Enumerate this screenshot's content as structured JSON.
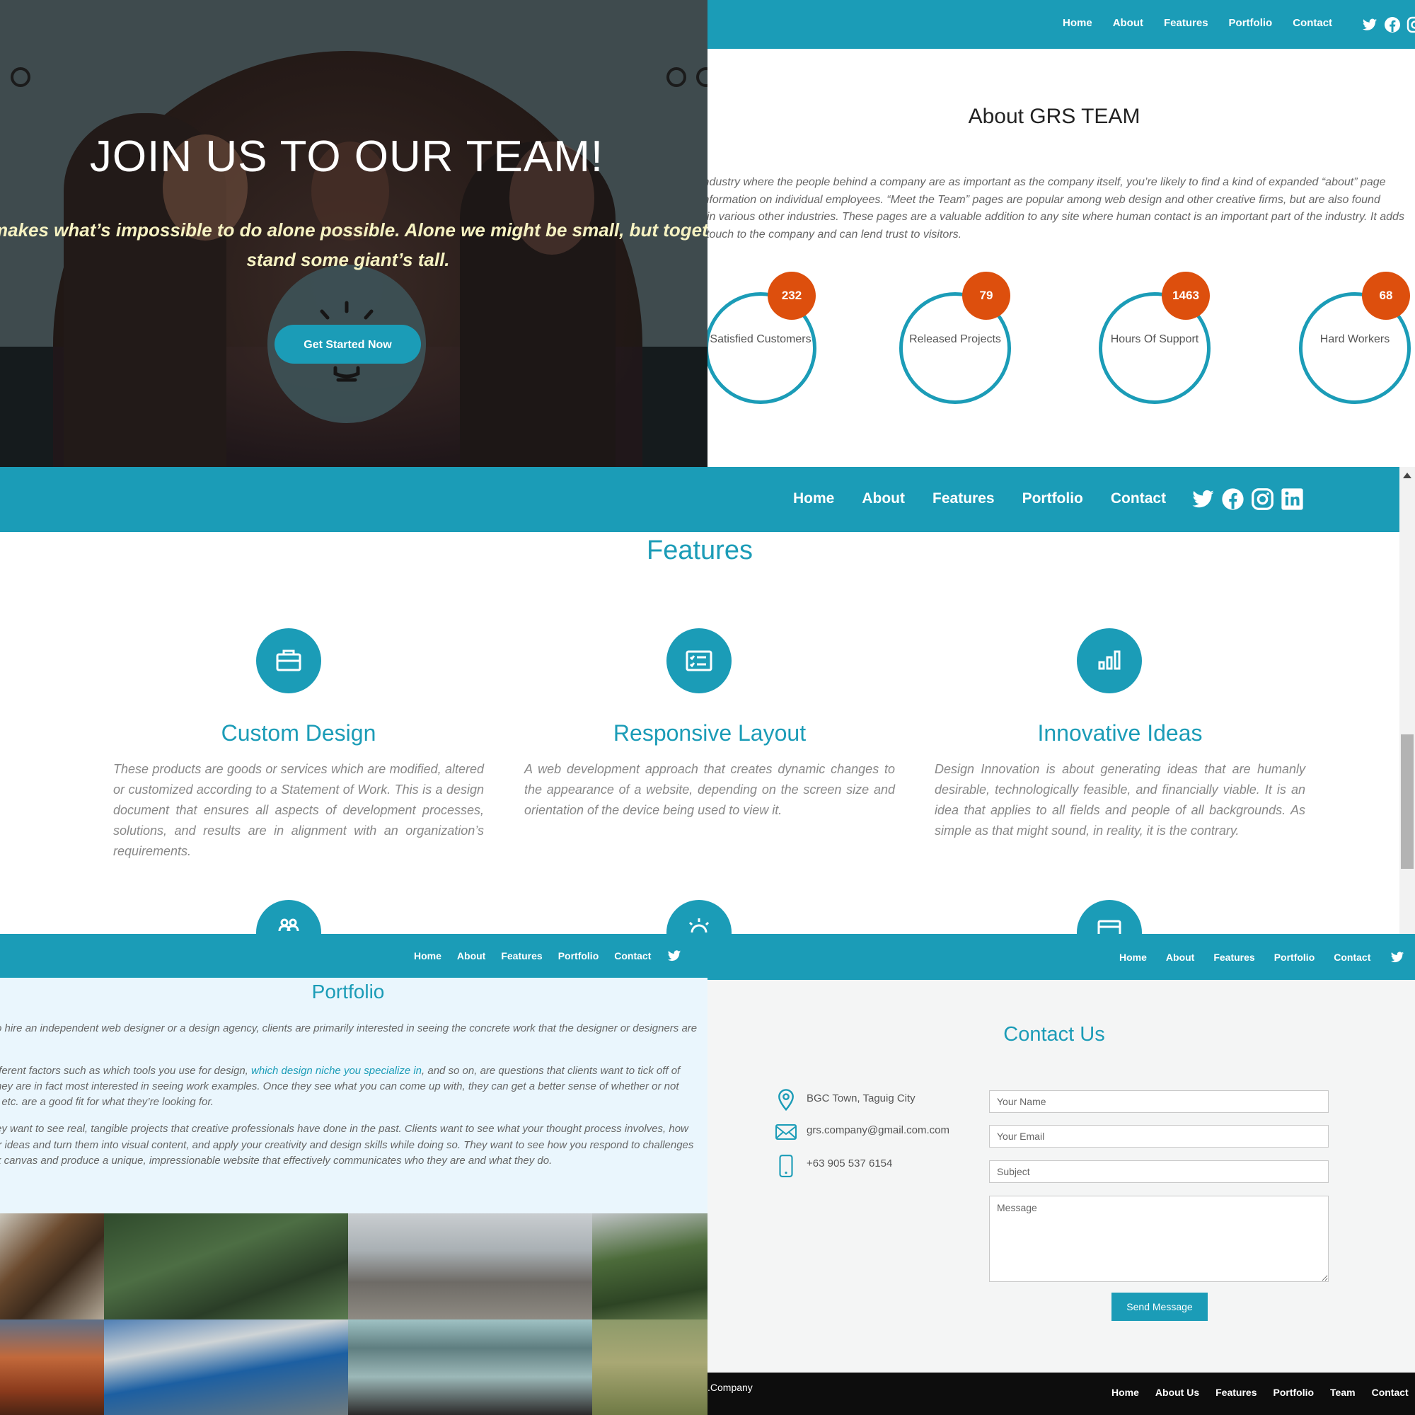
{
  "nav_labels": [
    "Home",
    "About",
    "Features",
    "Portfolio",
    "Contact"
  ],
  "brand_color": "#1b9cb7",
  "accent_color": "#dd4f0d",
  "hero": {
    "title": "JOIN US TO OUR TEAM!",
    "tagline_line1": "makes what’s impossible to do alone possible. Alone we might be small, but together",
    "tagline_line2": "stand some giant’s tall.",
    "cta_label": "Get Started Now"
  },
  "about": {
    "title": "About GRS TEAM",
    "paragraph_lines": [
      "industry where the people behind a company are as important as the company itself, you’re likely to find a kind of expanded “about” page",
      "information on individual employees. “Meet the Team” pages are popular among web design and other creative firms, but are also found",
      "hin various other industries. These pages are a valuable addition to any site where human contact is an important part of the industry. It adds",
      "l touch to the company and can lend trust to visitors."
    ],
    "stats": [
      {
        "value": "232",
        "label": "Satisfied Customers"
      },
      {
        "value": "79",
        "label": "Released Projects"
      },
      {
        "value": "1463",
        "label": "Hours Of Support"
      },
      {
        "value": "68",
        "label": "Hard Workers"
      }
    ]
  },
  "features": {
    "title": "Features",
    "items": [
      {
        "title": "Custom Design",
        "icon": "briefcase-icon",
        "text": "These products are goods or services which are modified, altered or customized according to a Statement of Work. This is a design document that ensures all aspects of development processes, solutions, and results are in alignment with an organization’s requirements."
      },
      {
        "title": "Responsive Layout",
        "icon": "checklist-icon",
        "text": "A web development approach that creates dynamic changes to the appearance of a website, depending on the screen size and orientation of the device being used to view it."
      },
      {
        "title": "Innovative Ideas",
        "icon": "bar-chart-icon",
        "text": "Design Innovation is about generating ideas that are humanly desirable, technologically feasible, and financially viable. It is an idea that applies to all fields and people of all backgrounds. As simple as that might sound, in reality, it is the contrary."
      }
    ],
    "next_row_icons": [
      "team-icon",
      "sun-icon",
      "calendar-icon"
    ]
  },
  "portfolio": {
    "title": "Portfolio",
    "line1": "o hire an independent web designer or a design agency, clients are primarily interested in seeing the concrete work that the designer or designers are",
    "line2a": "fferent factors such as which tools you use for design,",
    "line2_link": "which design niche you specialize in",
    "line2b": ", and so on, are questions that clients want to tick off of",
    "line3": "hey are in fact most interested in seeing work examples. Once they see what you can come up with, they can get a better sense of whether or not",
    "line4": ", etc. are a good fit for what they’re looking for.",
    "line5": "ey want to see real, tangible projects that creative professionals have done in the past. Clients want to see what your thought process involves, how",
    "line6": "ir ideas and turn them into visual content, and apply your creativity and design skills while doing so. They want to see how you respond to challenges",
    "line7": "k canvas and produce a unique, impressionable website that effectively communicates who they are and what they do."
  },
  "contact": {
    "title": "Contact Us",
    "address": "BGC Town, Taguig City",
    "email": "grs.company@gmail.com.com",
    "phone": "+63 905 537 6154",
    "name_placeholder": "Your Name",
    "email_placeholder": "Your Email",
    "subject_placeholder": "Subject",
    "message_placeholder": "Message",
    "send_label": "Send Message"
  },
  "footer": {
    "brand": ".Company",
    "links": [
      "Home",
      "About Us",
      "Features",
      "Portfolio",
      "Team",
      "Contact"
    ]
  }
}
